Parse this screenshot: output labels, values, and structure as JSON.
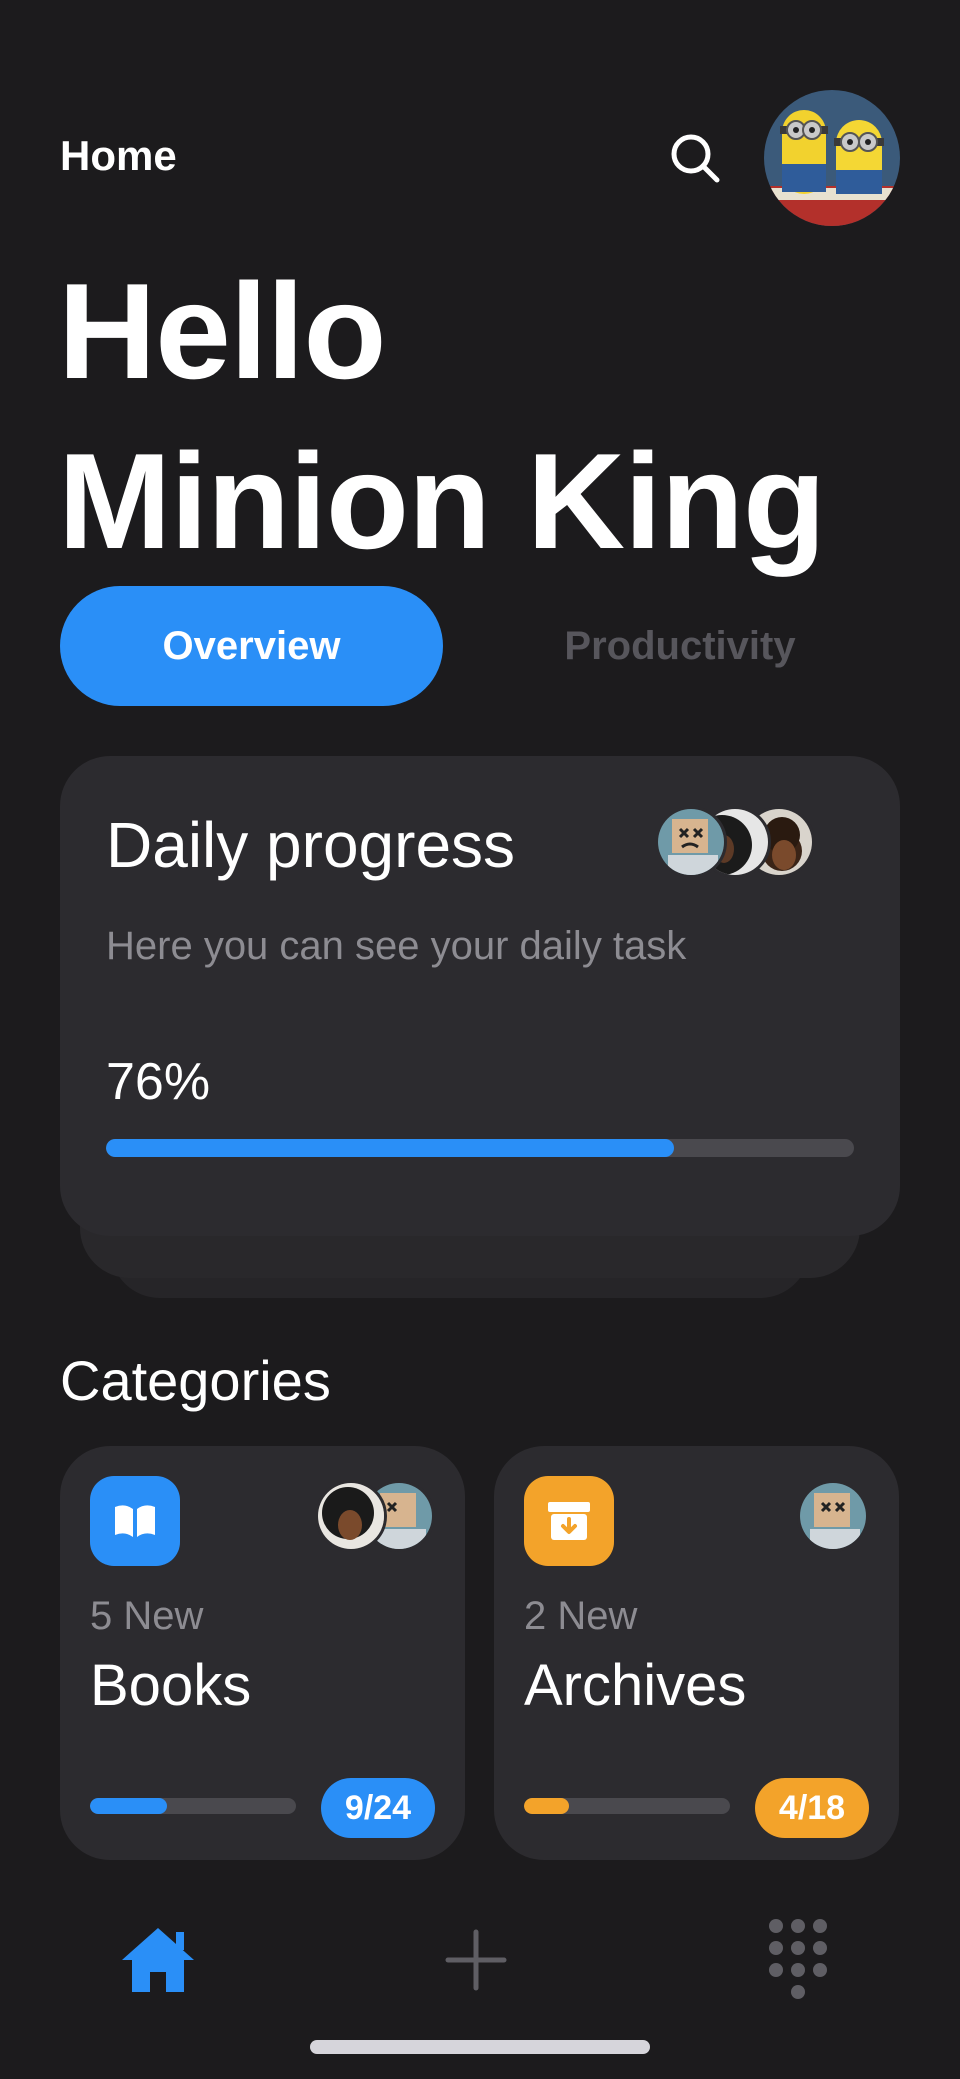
{
  "header": {
    "title": "Home"
  },
  "greeting": {
    "line1": "Hello",
    "line2": "Minion King"
  },
  "tabs": [
    {
      "label": "Overview",
      "active": true
    },
    {
      "label": "Productivity",
      "active": false
    }
  ],
  "daily_progress": {
    "title": "Daily progress",
    "subtitle": "Here you can see your daily task",
    "percent_label": "76%",
    "progress": 0.76
  },
  "categories": {
    "heading": "Categories",
    "items": [
      {
        "new_label": "5 New",
        "name": "Books",
        "badge": "9/24",
        "progress": 0.375,
        "color": "#2a8ff7",
        "icon": "book-icon"
      },
      {
        "new_label": "2 New",
        "name": "Archives",
        "badge": "4/18",
        "progress": 0.22,
        "color": "#f3a32a",
        "icon": "archive-icon"
      }
    ]
  },
  "nav": {
    "items": [
      {
        "icon": "home-icon",
        "active": true
      },
      {
        "icon": "plus-icon",
        "active": false
      },
      {
        "icon": "dial-grid-icon",
        "active": false
      }
    ]
  },
  "colors": {
    "background": "#1c1b1d",
    "card": "#2c2b2f",
    "accent_blue": "#2a8ff7",
    "accent_orange": "#f3a32a",
    "muted_text": "#8d8c92"
  }
}
